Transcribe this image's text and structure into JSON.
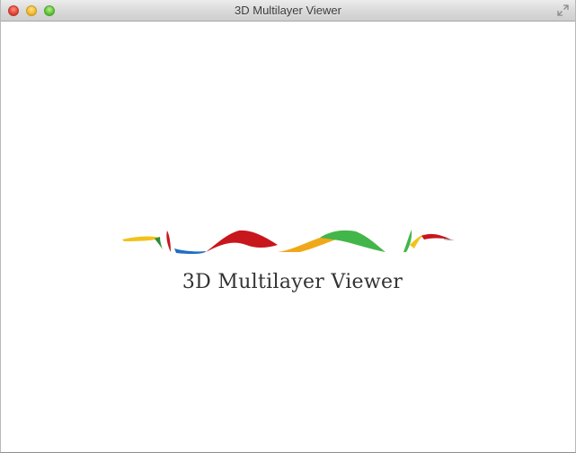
{
  "window": {
    "title": "3D Multilayer Viewer"
  },
  "titlebar_controls": [
    "close-icon",
    "minimize-icon",
    "zoom-icon",
    "fullscreen-icon"
  ],
  "splash": {
    "app_name": "3D Multilayer Viewer",
    "logo_colors": [
      "#f2c21b",
      "#2e8b3a",
      "#c8161d",
      "#1f6fc1",
      "#f0a81a",
      "#43b649"
    ]
  }
}
